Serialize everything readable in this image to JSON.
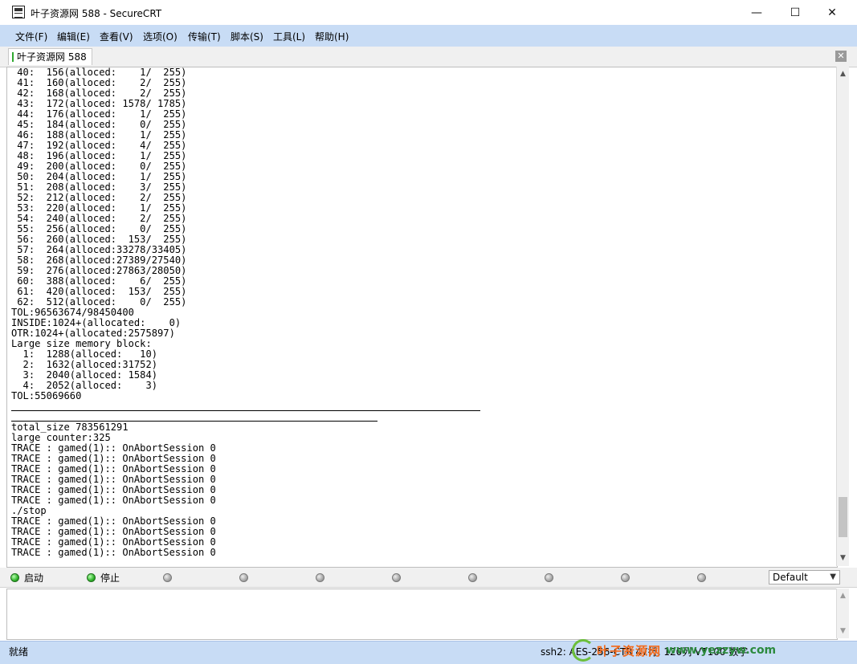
{
  "window": {
    "title": "叶子资源网 588 - SecureCRT",
    "controls": {
      "minimize": "—",
      "maximize": "☐",
      "close": "✕"
    }
  },
  "menu": {
    "items": [
      "文件(F)",
      "编辑(E)",
      "查看(V)",
      "选项(O)",
      "传输(T)",
      "脚本(S)",
      "工具(L)",
      "帮助(H)"
    ]
  },
  "tabs": {
    "active": "叶子资源网 588",
    "close": "✕"
  },
  "terminal": {
    "lines": [
      " 40:  156(alloced:    1/  255)",
      " 41:  160(alloced:    2/  255)",
      " 42:  168(alloced:    2/  255)",
      " 43:  172(alloced: 1578/ 1785)",
      " 44:  176(alloced:    1/  255)",
      " 45:  184(alloced:    0/  255)",
      " 46:  188(alloced:    1/  255)",
      " 47:  192(alloced:    4/  255)",
      " 48:  196(alloced:    1/  255)",
      " 49:  200(alloced:    0/  255)",
      " 50:  204(alloced:    1/  255)",
      " 51:  208(alloced:    3/  255)",
      " 52:  212(alloced:    2/  255)",
      " 53:  220(alloced:    1/  255)",
      " 54:  240(alloced:    2/  255)",
      " 55:  256(alloced:    0/  255)",
      " 56:  260(alloced:  153/  255)",
      " 57:  264(alloced:33278/33405)",
      " 58:  268(alloced:27389/27540)",
      " 59:  276(alloced:27863/28050)",
      " 60:  388(alloced:    6/  255)",
      " 61:  420(alloced:  153/  255)",
      " 62:  512(alloced:    0/  255)",
      "TOL:96563674/98450400",
      "INSIDE:1024+(allocated:    0)",
      "OTR:1024+(allocated:2575897)",
      "Large size memory block:",
      "  1:  1288(alloced:   10)",
      "  2:  1632(alloced:31752)",
      "  3:  2040(alloced: 1584)",
      "  4:  2052(alloced:    3)",
      "TOL:55069660",
      "",
      "",
      "total_size 783561291",
      "large counter:325",
      "TRACE : gamed(1):: OnAbortSession 0",
      "TRACE : gamed(1):: OnAbortSession 0",
      "TRACE : gamed(1):: OnAbortSession 0",
      "TRACE : gamed(1):: OnAbortSession 0",
      "TRACE : gamed(1):: OnAbortSession 0",
      "TRACE : gamed(1):: OnAbortSession 0",
      "./stop",
      "TRACE : gamed(1):: OnAbortSession 0",
      "TRACE : gamed(1):: OnAbortSession 0",
      "TRACE : gamed(1):: OnAbortSession 0",
      "TRACE : gamed(1):: OnAbortSession 0"
    ]
  },
  "button_bar": {
    "start_label": "启动",
    "stop_label": "停止",
    "session_select": "Default"
  },
  "status": {
    "ready": "就绪",
    "right": "ssh2: AES-256-CTR   47行, 120列 VT100   数字"
  },
  "watermark": {
    "cn": "叶子资源网",
    "url": "www.yezzyw.com"
  }
}
